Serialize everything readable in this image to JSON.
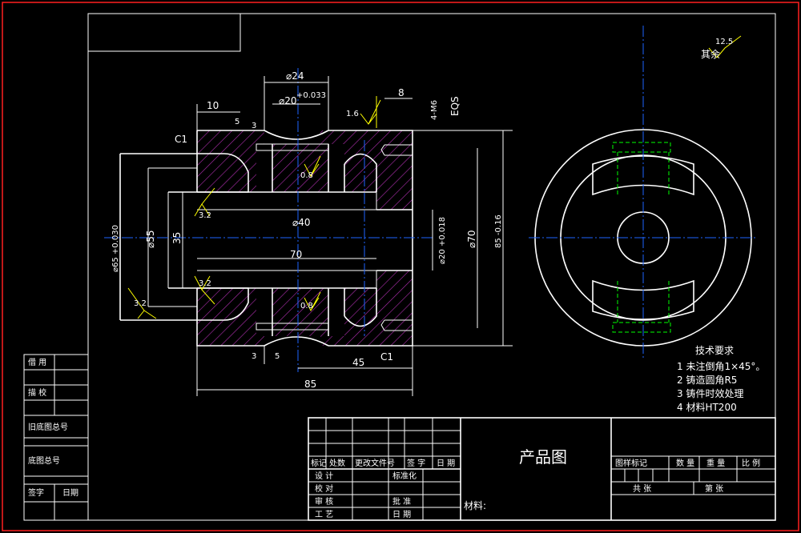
{
  "colors": {
    "background": "#000000",
    "outer_frame": "#ff2020",
    "lines": "#ffffff",
    "dimensions": "#ffffff",
    "roughness_marks": "#ffff00",
    "hidden_lines": "#00ff00",
    "center_lines": "#1e64ff",
    "hatch": "#b02fb0"
  },
  "roughness": {
    "global_value": "12.5",
    "global_label": "其余",
    "marks": [
      "3.2",
      "3.2",
      "3.2",
      "0.8",
      "0.8",
      "1.6"
    ]
  },
  "dimensions": {
    "d24": "⌀24",
    "d20_tol": "⌀20",
    "d20_tol_sup": "+0.033",
    "w10": "10",
    "w5_top": "5",
    "w3_top": "3",
    "w8": "8",
    "m6": "4-M6",
    "eqs": "EQS",
    "c1_top": "C1",
    "c1_bottom": "C1",
    "d65": "⌀65 +0.030",
    "d55": "⌀55",
    "v35": "35",
    "d40": "⌀40",
    "v70": "70",
    "d20_mid": "⌀20 +0.018",
    "d70": "⌀70",
    "v85_right": "85 -0.16",
    "w45": "45",
    "w85": "85",
    "w5_bot": "5",
    "w3_bot": "3"
  },
  "tech_requirements": {
    "title": "技术要求",
    "items": [
      "1 未注倒角1×45°。",
      "2 铸造圆角R5",
      "3 铸件时效处理",
      "4 材料HT200"
    ]
  },
  "left_strip": {
    "rows": [
      "借  用",
      "描  校",
      "旧底图总号",
      "底图总号",
      "签字",
      "日期"
    ]
  },
  "title_block": {
    "drawing_name": "产品图",
    "material_label": "材料:",
    "revision_header": [
      "标记",
      "处数",
      "更改文件号",
      "签  字",
      "日  期"
    ],
    "sign_rows": [
      [
        "设  计",
        "标准化"
      ],
      [
        "校  对",
        ""
      ],
      [
        "审  核",
        "批  准"
      ],
      [
        "工  艺",
        "日  期"
      ]
    ],
    "right_header": [
      "图样标记",
      "数  量",
      "重  量",
      "比  例"
    ],
    "sheet_labels": [
      "共    张",
      "第    张"
    ]
  }
}
